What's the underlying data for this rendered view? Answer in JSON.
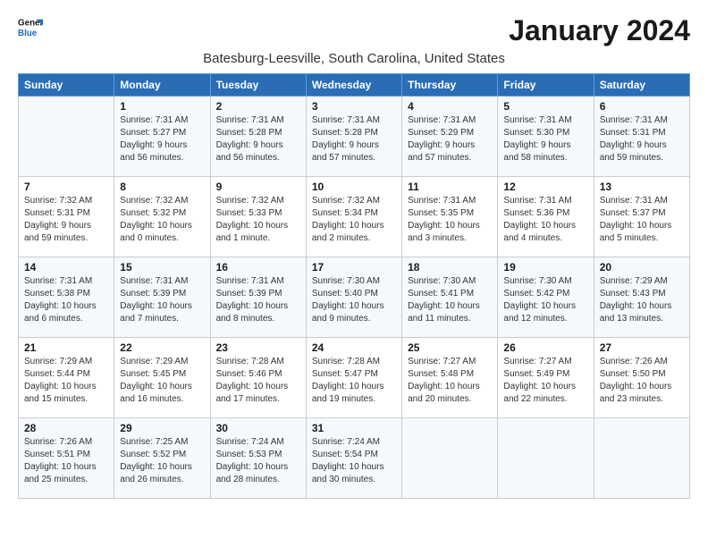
{
  "logo": {
    "text_general": "General",
    "text_blue": "Blue"
  },
  "header": {
    "month": "January 2024",
    "location": "Batesburg-Leesville, South Carolina, United States"
  },
  "weekdays": [
    "Sunday",
    "Monday",
    "Tuesday",
    "Wednesday",
    "Thursday",
    "Friday",
    "Saturday"
  ],
  "weeks": [
    [
      {
        "day": "",
        "sunrise": "",
        "sunset": "",
        "daylight": ""
      },
      {
        "day": "1",
        "sunrise": "Sunrise: 7:31 AM",
        "sunset": "Sunset: 5:27 PM",
        "daylight": "Daylight: 9 hours and 56 minutes."
      },
      {
        "day": "2",
        "sunrise": "Sunrise: 7:31 AM",
        "sunset": "Sunset: 5:28 PM",
        "daylight": "Daylight: 9 hours and 56 minutes."
      },
      {
        "day": "3",
        "sunrise": "Sunrise: 7:31 AM",
        "sunset": "Sunset: 5:28 PM",
        "daylight": "Daylight: 9 hours and 57 minutes."
      },
      {
        "day": "4",
        "sunrise": "Sunrise: 7:31 AM",
        "sunset": "Sunset: 5:29 PM",
        "daylight": "Daylight: 9 hours and 57 minutes."
      },
      {
        "day": "5",
        "sunrise": "Sunrise: 7:31 AM",
        "sunset": "Sunset: 5:30 PM",
        "daylight": "Daylight: 9 hours and 58 minutes."
      },
      {
        "day": "6",
        "sunrise": "Sunrise: 7:31 AM",
        "sunset": "Sunset: 5:31 PM",
        "daylight": "Daylight: 9 hours and 59 minutes."
      }
    ],
    [
      {
        "day": "7",
        "sunrise": "Sunrise: 7:32 AM",
        "sunset": "Sunset: 5:31 PM",
        "daylight": "Daylight: 9 hours and 59 minutes."
      },
      {
        "day": "8",
        "sunrise": "Sunrise: 7:32 AM",
        "sunset": "Sunset: 5:32 PM",
        "daylight": "Daylight: 10 hours and 0 minutes."
      },
      {
        "day": "9",
        "sunrise": "Sunrise: 7:32 AM",
        "sunset": "Sunset: 5:33 PM",
        "daylight": "Daylight: 10 hours and 1 minute."
      },
      {
        "day": "10",
        "sunrise": "Sunrise: 7:32 AM",
        "sunset": "Sunset: 5:34 PM",
        "daylight": "Daylight: 10 hours and 2 minutes."
      },
      {
        "day": "11",
        "sunrise": "Sunrise: 7:31 AM",
        "sunset": "Sunset: 5:35 PM",
        "daylight": "Daylight: 10 hours and 3 minutes."
      },
      {
        "day": "12",
        "sunrise": "Sunrise: 7:31 AM",
        "sunset": "Sunset: 5:36 PM",
        "daylight": "Daylight: 10 hours and 4 minutes."
      },
      {
        "day": "13",
        "sunrise": "Sunrise: 7:31 AM",
        "sunset": "Sunset: 5:37 PM",
        "daylight": "Daylight: 10 hours and 5 minutes."
      }
    ],
    [
      {
        "day": "14",
        "sunrise": "Sunrise: 7:31 AM",
        "sunset": "Sunset: 5:38 PM",
        "daylight": "Daylight: 10 hours and 6 minutes."
      },
      {
        "day": "15",
        "sunrise": "Sunrise: 7:31 AM",
        "sunset": "Sunset: 5:39 PM",
        "daylight": "Daylight: 10 hours and 7 minutes."
      },
      {
        "day": "16",
        "sunrise": "Sunrise: 7:31 AM",
        "sunset": "Sunset: 5:39 PM",
        "daylight": "Daylight: 10 hours and 8 minutes."
      },
      {
        "day": "17",
        "sunrise": "Sunrise: 7:30 AM",
        "sunset": "Sunset: 5:40 PM",
        "daylight": "Daylight: 10 hours and 9 minutes."
      },
      {
        "day": "18",
        "sunrise": "Sunrise: 7:30 AM",
        "sunset": "Sunset: 5:41 PM",
        "daylight": "Daylight: 10 hours and 11 minutes."
      },
      {
        "day": "19",
        "sunrise": "Sunrise: 7:30 AM",
        "sunset": "Sunset: 5:42 PM",
        "daylight": "Daylight: 10 hours and 12 minutes."
      },
      {
        "day": "20",
        "sunrise": "Sunrise: 7:29 AM",
        "sunset": "Sunset: 5:43 PM",
        "daylight": "Daylight: 10 hours and 13 minutes."
      }
    ],
    [
      {
        "day": "21",
        "sunrise": "Sunrise: 7:29 AM",
        "sunset": "Sunset: 5:44 PM",
        "daylight": "Daylight: 10 hours and 15 minutes."
      },
      {
        "day": "22",
        "sunrise": "Sunrise: 7:29 AM",
        "sunset": "Sunset: 5:45 PM",
        "daylight": "Daylight: 10 hours and 16 minutes."
      },
      {
        "day": "23",
        "sunrise": "Sunrise: 7:28 AM",
        "sunset": "Sunset: 5:46 PM",
        "daylight": "Daylight: 10 hours and 17 minutes."
      },
      {
        "day": "24",
        "sunrise": "Sunrise: 7:28 AM",
        "sunset": "Sunset: 5:47 PM",
        "daylight": "Daylight: 10 hours and 19 minutes."
      },
      {
        "day": "25",
        "sunrise": "Sunrise: 7:27 AM",
        "sunset": "Sunset: 5:48 PM",
        "daylight": "Daylight: 10 hours and 20 minutes."
      },
      {
        "day": "26",
        "sunrise": "Sunrise: 7:27 AM",
        "sunset": "Sunset: 5:49 PM",
        "daylight": "Daylight: 10 hours and 22 minutes."
      },
      {
        "day": "27",
        "sunrise": "Sunrise: 7:26 AM",
        "sunset": "Sunset: 5:50 PM",
        "daylight": "Daylight: 10 hours and 23 minutes."
      }
    ],
    [
      {
        "day": "28",
        "sunrise": "Sunrise: 7:26 AM",
        "sunset": "Sunset: 5:51 PM",
        "daylight": "Daylight: 10 hours and 25 minutes."
      },
      {
        "day": "29",
        "sunrise": "Sunrise: 7:25 AM",
        "sunset": "Sunset: 5:52 PM",
        "daylight": "Daylight: 10 hours and 26 minutes."
      },
      {
        "day": "30",
        "sunrise": "Sunrise: 7:24 AM",
        "sunset": "Sunset: 5:53 PM",
        "daylight": "Daylight: 10 hours and 28 minutes."
      },
      {
        "day": "31",
        "sunrise": "Sunrise: 7:24 AM",
        "sunset": "Sunset: 5:54 PM",
        "daylight": "Daylight: 10 hours and 30 minutes."
      },
      {
        "day": "",
        "sunrise": "",
        "sunset": "",
        "daylight": ""
      },
      {
        "day": "",
        "sunrise": "",
        "sunset": "",
        "daylight": ""
      },
      {
        "day": "",
        "sunrise": "",
        "sunset": "",
        "daylight": ""
      }
    ]
  ]
}
